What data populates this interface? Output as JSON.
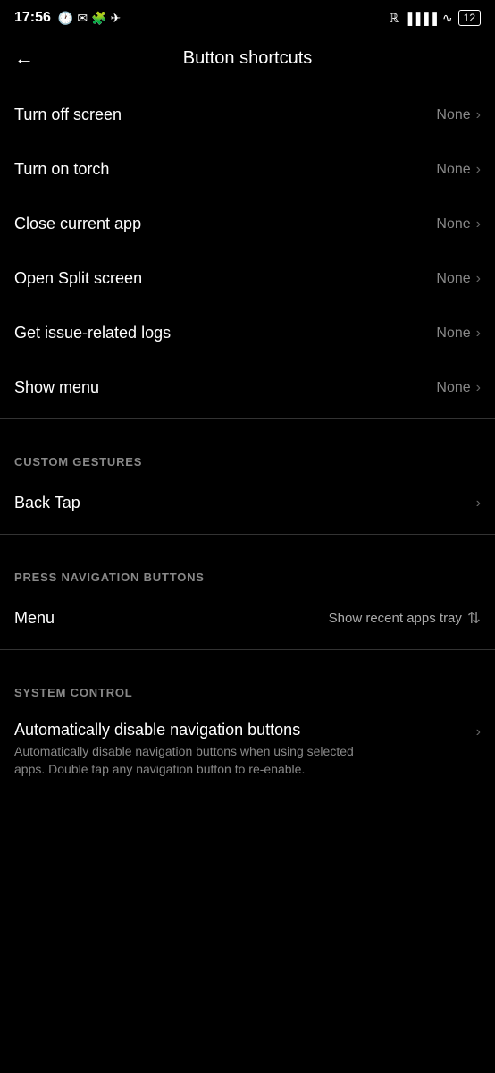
{
  "statusBar": {
    "time": "17:56",
    "icons": [
      "alarm",
      "email",
      "puzzle",
      "telegram"
    ],
    "rightIcons": {
      "bluetooth": "⬥",
      "signal": "▐▐▐▐",
      "wifi": "wifi",
      "battery": "12"
    }
  },
  "header": {
    "backLabel": "←",
    "title": "Button shortcuts"
  },
  "shortcuts": [
    {
      "label": "Turn off screen",
      "value": "None"
    },
    {
      "label": "Turn on torch",
      "value": "None"
    },
    {
      "label": "Close current app",
      "value": "None"
    },
    {
      "label": "Open Split screen",
      "value": "None"
    },
    {
      "label": "Get issue-related logs",
      "value": "None"
    },
    {
      "label": "Show menu",
      "value": "None"
    }
  ],
  "sections": {
    "customGestures": {
      "header": "CUSTOM GESTURES",
      "items": [
        {
          "label": "Back Tap",
          "value": ""
        }
      ]
    },
    "pressNavigation": {
      "header": "PRESS NAVIGATION BUTTONS",
      "items": [
        {
          "label": "Menu",
          "value": "Show recent apps tray"
        }
      ]
    },
    "systemControl": {
      "header": "SYSTEM CONTROL",
      "items": [
        {
          "label": "Automatically disable navigation buttons",
          "sublabel": "Automatically disable navigation buttons when using selected apps. Double tap any navigation button to re-enable.",
          "value": ""
        }
      ]
    }
  }
}
